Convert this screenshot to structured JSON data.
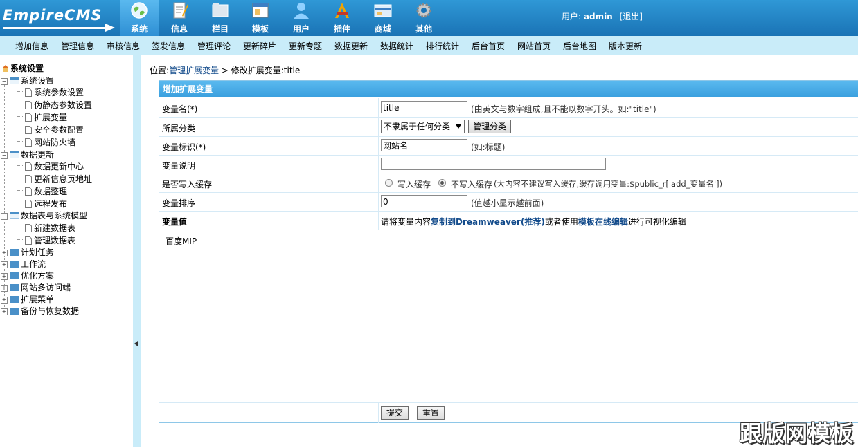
{
  "brand": {
    "logo_text": "EmpireCMS"
  },
  "top_nav": [
    {
      "label": "系统",
      "icon": "globe-icon"
    },
    {
      "label": "信息",
      "icon": "notepad-icon"
    },
    {
      "label": "栏目",
      "icon": "folder-icon"
    },
    {
      "label": "模板",
      "icon": "window-icon"
    },
    {
      "label": "用户",
      "icon": "user-icon"
    },
    {
      "label": "插件",
      "icon": "tools-icon"
    },
    {
      "label": "商城",
      "icon": "card-icon"
    },
    {
      "label": "其他",
      "icon": "gear-icon"
    }
  ],
  "user": {
    "label": "用户:",
    "name": "admin",
    "logout": "[退出]"
  },
  "menu": [
    "增加信息",
    "管理信息",
    "审核信息",
    "签发信息",
    "管理评论",
    "更新碎片",
    "更新专题",
    "数据更新",
    "数据统计",
    "排行统计",
    "后台首页",
    "网站首页",
    "后台地图",
    "版本更新"
  ],
  "sidebar": {
    "root": "系统设置",
    "groups": [
      {
        "label": "系统设置",
        "expanded": true,
        "items": [
          "系统参数设置",
          "伪静态参数设置",
          "扩展变量",
          "安全参数配置",
          "网站防火墙"
        ]
      },
      {
        "label": "数据更新",
        "expanded": true,
        "items": [
          "数据更新中心",
          "更新信息页地址",
          "数据整理",
          "远程发布"
        ]
      },
      {
        "label": "数据表与系统模型",
        "expanded": true,
        "items": [
          "新建数据表",
          "管理数据表"
        ]
      },
      {
        "label": "计划任务",
        "expanded": false,
        "items": []
      },
      {
        "label": "工作流",
        "expanded": false,
        "items": []
      },
      {
        "label": "优化方案",
        "expanded": false,
        "items": []
      },
      {
        "label": "网站多访问端",
        "expanded": false,
        "items": []
      },
      {
        "label": "扩展菜单",
        "expanded": false,
        "items": []
      },
      {
        "label": "备份与恢复数据",
        "expanded": false,
        "items": []
      }
    ]
  },
  "breadcrumb": {
    "prefix": "位置:",
    "link": "管理扩展变量",
    "sep": " > ",
    "current": "修改扩展变量:title"
  },
  "form": {
    "title": "增加扩展变量",
    "var_name": {
      "label": "变量名(*)",
      "value": "title",
      "hint": "(由英文与数字组成,且不能以数字开头。如:\"title\")"
    },
    "category": {
      "label": "所属分类",
      "selected": "不隶属于任何分类",
      "manage_button": "管理分类"
    },
    "var_title": {
      "label": "变量标识(*)",
      "value": "网站名",
      "hint": "(如:标题)"
    },
    "var_desc": {
      "label": "变量说明",
      "value": ""
    },
    "cache": {
      "label": "是否写入缓存",
      "opt_yes": "写入缓存",
      "opt_no": "不写入缓存",
      "selected": "不写入缓存",
      "hint": "(大内容不建议写入缓存,缓存调用变量:$public_r['add_变量名'])"
    },
    "order": {
      "label": "变量排序",
      "value": "0",
      "hint": "(值越小显示越前面)"
    },
    "value": {
      "label": "变量值",
      "hint_pre": "请将变量内容",
      "hint_link1": "复制到Dreamweaver(推荐)",
      "hint_mid": "或者使用",
      "hint_link2": "模板在线编辑",
      "hint_post": "进行可视化编辑",
      "content": "百度MIP"
    },
    "submit": "提交",
    "reset": "重置"
  },
  "watermark": "跟版网模板"
}
